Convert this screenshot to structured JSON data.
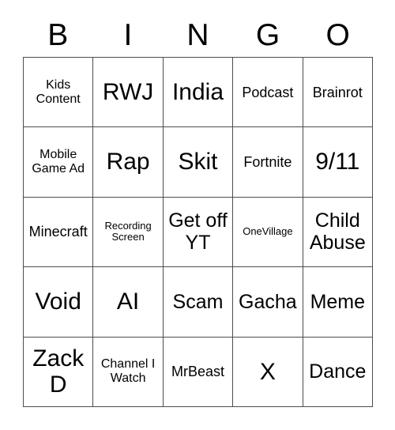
{
  "card": {
    "header_letters": [
      "B",
      "I",
      "N",
      "G",
      "O"
    ],
    "rows": [
      [
        {
          "text": "Kids Content",
          "size": "sm"
        },
        {
          "text": "RWJ",
          "size": "xl"
        },
        {
          "text": "India",
          "size": "xl"
        },
        {
          "text": "Podcast",
          "size": "md"
        },
        {
          "text": "Brainrot",
          "size": "md"
        }
      ],
      [
        {
          "text": "Mobile Game Ad",
          "size": "sm"
        },
        {
          "text": "Rap",
          "size": "xl"
        },
        {
          "text": "Skit",
          "size": "xl"
        },
        {
          "text": "Fortnite",
          "size": "md"
        },
        {
          "text": "9/11",
          "size": "xl"
        }
      ],
      [
        {
          "text": "Minecraft",
          "size": "md"
        },
        {
          "text": "Recording Screen",
          "size": "xs"
        },
        {
          "text": "Get off YT",
          "size": "lg"
        },
        {
          "text": "OneVillage",
          "size": "xs"
        },
        {
          "text": "Child Abuse",
          "size": "lg"
        }
      ],
      [
        {
          "text": "Void",
          "size": "xl"
        },
        {
          "text": "AI",
          "size": "xl"
        },
        {
          "text": "Scam",
          "size": "lg"
        },
        {
          "text": "Gacha",
          "size": "lg"
        },
        {
          "text": "Meme",
          "size": "lg"
        }
      ],
      [
        {
          "text": "Zack D",
          "size": "xl"
        },
        {
          "text": "Channel I Watch",
          "size": "sm"
        },
        {
          "text": "MrBeast",
          "size": "md"
        },
        {
          "text": "X",
          "size": "xl"
        },
        {
          "text": "Dance",
          "size": "lg"
        }
      ]
    ],
    "colors": {
      "background": "#ffffff",
      "text": "#000000",
      "grid_line": "#4d4d4d"
    }
  }
}
